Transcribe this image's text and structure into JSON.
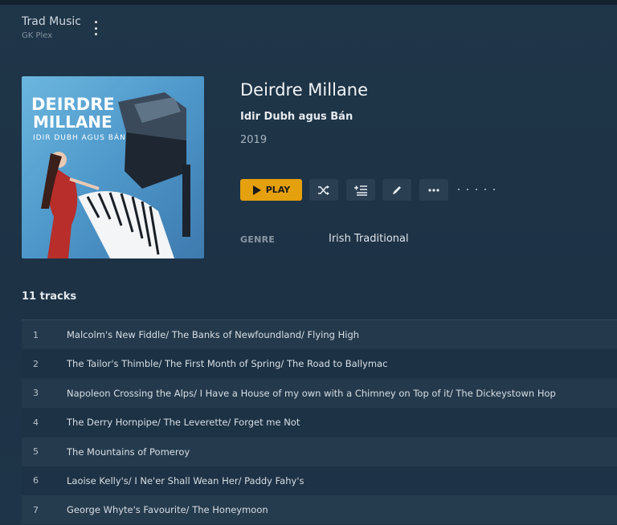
{
  "library": {
    "title": "Trad Music",
    "server": "GK Plex"
  },
  "album": {
    "artist": "Deirdre Millane",
    "title": "Idir Dubh agus Bán",
    "year": "2019",
    "cover_text_line1": "DEIRDRE",
    "cover_text_line2": "MILLANE",
    "cover_text_line3": "IDIR DUBH AGUS BÁN"
  },
  "actions": {
    "play_label": "PLAY"
  },
  "genre": {
    "label": "GENRE",
    "value": "Irish Traditional"
  },
  "tracks_header": "11 tracks",
  "tracks": [
    {
      "number": "1",
      "title": "Malcolm's New Fiddle/ The Banks of Newfoundland/ Flying High"
    },
    {
      "number": "2",
      "title": "The Tailor's Thimble/ The First Month of Spring/ The Road to Ballymac"
    },
    {
      "number": "3",
      "title": "Napoleon Crossing the Alps/ I Have a House of my own with a Chimney on Top of it/ The Dickeystown Hop"
    },
    {
      "number": "4",
      "title": "The Derry Hornpipe/ The Leverette/ Forget me Not"
    },
    {
      "number": "5",
      "title": "The Mountains of Pomeroy"
    },
    {
      "number": "6",
      "title": "Laoise Kelly's/ I Ne'er Shall Wean Her/ Paddy Fahy's"
    },
    {
      "number": "7",
      "title": "George Whyte's Favourite/ The Honeymoon"
    }
  ],
  "colors": {
    "accent": "#e5a00d",
    "background": "#1e3346"
  }
}
